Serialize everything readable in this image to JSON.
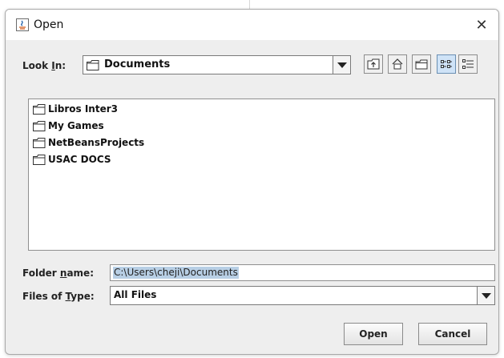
{
  "dialog": {
    "title": "Open",
    "title_icon": "java-app-icon",
    "close_glyph": "✕"
  },
  "look_in": {
    "label_pre": "Look ",
    "label_mnemonic": "I",
    "label_post": "n:",
    "value": "Documents",
    "value_icon": "folder-icon"
  },
  "toolbar": {
    "buttons": [
      {
        "name": "up-one-level",
        "icon": "up-folder-icon"
      },
      {
        "name": "home",
        "icon": "home-icon"
      },
      {
        "name": "create-new-folder",
        "icon": "new-folder-icon"
      },
      {
        "name": "list-view",
        "icon": "list-view-icon",
        "pressed": true
      },
      {
        "name": "details-view",
        "icon": "details-view-icon"
      }
    ]
  },
  "files": [
    {
      "name": "Libros Inter3",
      "icon": "folder-icon"
    },
    {
      "name": "My Games",
      "icon": "folder-icon"
    },
    {
      "name": "NetBeansProjects",
      "icon": "folder-icon"
    },
    {
      "name": "USAC DOCS",
      "icon": "folder-icon"
    }
  ],
  "folder_name": {
    "label_pre": "Folder ",
    "label_mnemonic": "n",
    "label_post": "ame:",
    "value": "C:\\Users\\cheji\\Documents"
  },
  "file_type": {
    "label_pre": "Files of ",
    "label_mnemonic": "T",
    "label_post": "ype:",
    "value": "All Files"
  },
  "actions": {
    "open_label": "Open",
    "cancel_label": "Cancel"
  },
  "colors": {
    "dialog_bg": "#eeeeee",
    "selection": "#b8cfe5",
    "pressed_toggle": "#cfe3f7"
  }
}
